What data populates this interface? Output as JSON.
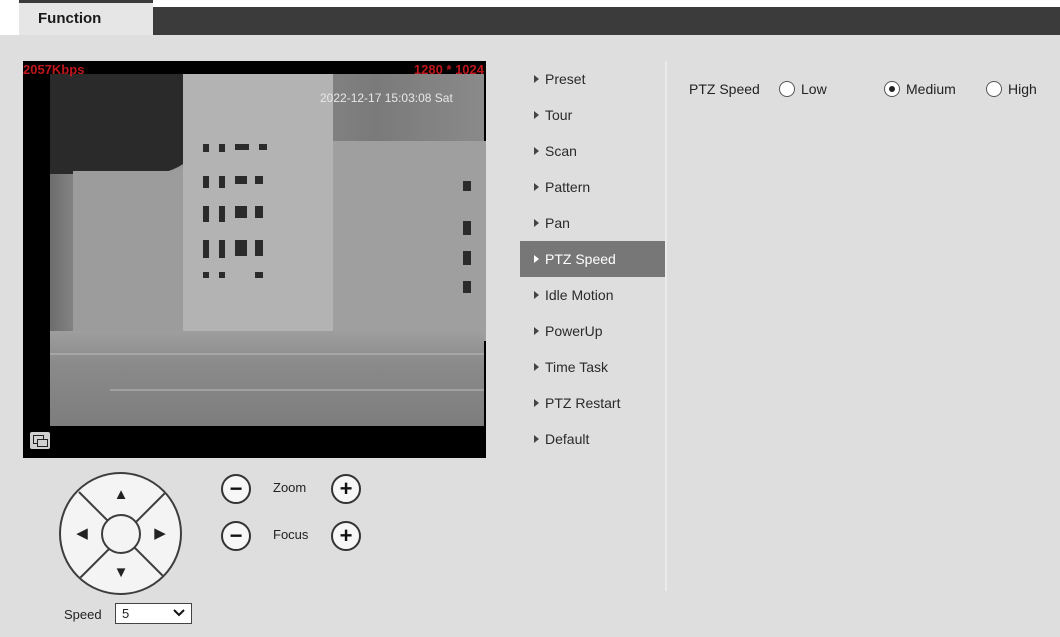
{
  "tabs": {
    "active": "Function"
  },
  "video": {
    "bitrate": "2057Kbps",
    "resolution": "1280 * 1024",
    "timestamp": "2022-12-17 15:03:08 Sat"
  },
  "ptz": {
    "zoom_label": "Zoom",
    "focus_label": "Focus",
    "minus": "−",
    "plus": "+",
    "speed_label": "Speed",
    "speed_value": "5"
  },
  "menu": {
    "items": [
      {
        "label": "Preset"
      },
      {
        "label": "Tour"
      },
      {
        "label": "Scan"
      },
      {
        "label": "Pattern"
      },
      {
        "label": "Pan"
      },
      {
        "label": "PTZ Speed",
        "active": true
      },
      {
        "label": "Idle Motion"
      },
      {
        "label": "PowerUp"
      },
      {
        "label": "Time Task"
      },
      {
        "label": "PTZ Restart"
      },
      {
        "label": "Default"
      }
    ]
  },
  "settings": {
    "ptz_speed_label": "PTZ Speed",
    "options": [
      "Low",
      "Medium",
      "High"
    ],
    "selected": "Medium"
  },
  "colors": {
    "overlay_red": "#c0171c",
    "menu_active_bg": "#777777",
    "panel_bg": "#dedede",
    "topbar_dark": "#3b3b3b"
  }
}
